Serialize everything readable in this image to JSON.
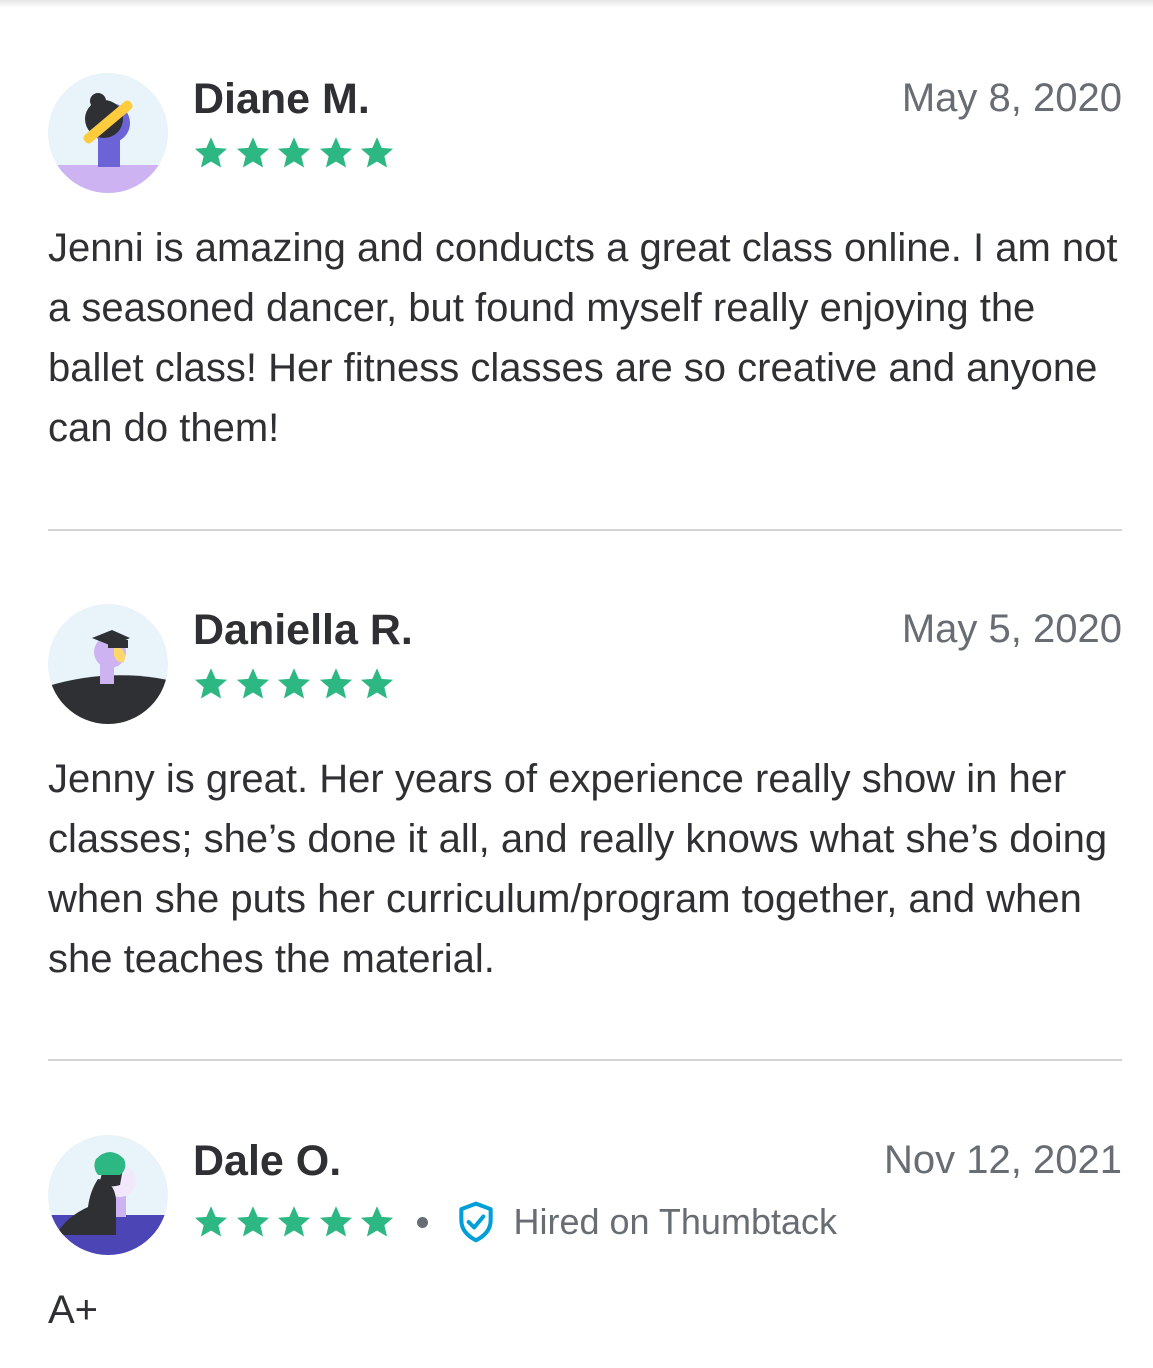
{
  "reviews": [
    {
      "name": "Diane M.",
      "date": "May 8, 2020",
      "rating": 5,
      "avatar_icon": "avatar-illustration-icon",
      "text": "Jenni is amazing and conducts a great class online. I am not a seasoned dancer, but found myself really enjoying the ballet class! Her fitness classes are so creative and anyone can do them!"
    },
    {
      "name": "Daniella R.",
      "date": "May 5, 2020",
      "rating": 5,
      "avatar_icon": "avatar-illustration-icon",
      "text": "Jenny is great. Her years of experience really show in her classes; she’s done it all, and really knows what she’s doing when she puts her curriculum/program together, and when she teaches the material."
    },
    {
      "name": "Dale O.",
      "date": "Nov 12, 2021",
      "rating": 5,
      "avatar_icon": "avatar-illustration-icon",
      "badge": "Hired on Thumbtack",
      "badge_icon": "verified-shield-icon",
      "text": "A+"
    }
  ],
  "colors": {
    "star": "#2db783",
    "verified": "#009fd9",
    "text": "#2f3033",
    "muted": "#676d73",
    "divider": "#d3d4d5"
  }
}
